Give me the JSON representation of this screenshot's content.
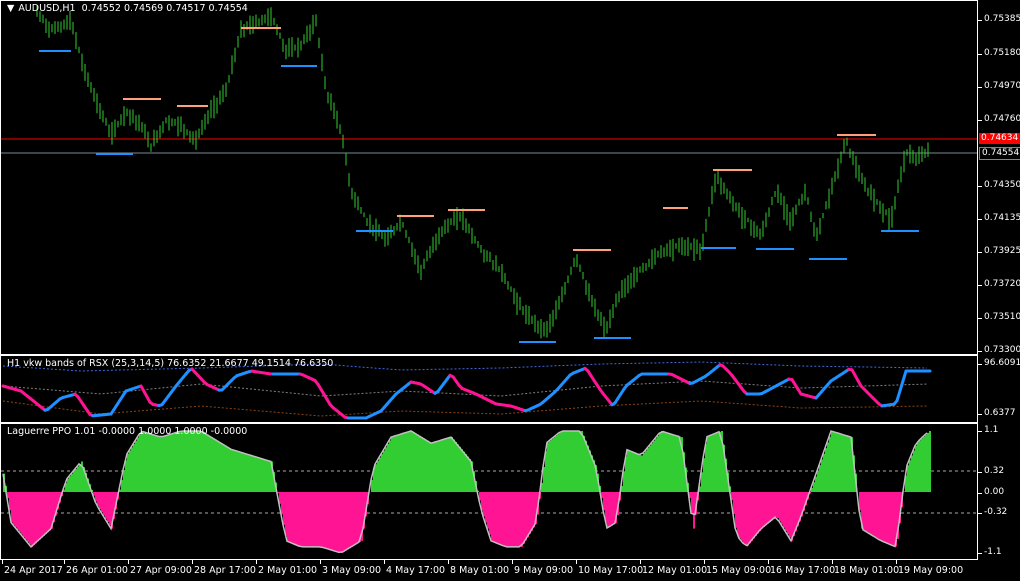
{
  "main": {
    "header": {
      "dropdown_icon": "triangle-down-icon",
      "symbol": "AUDUSD,H1",
      "values": "0.74552 0.74569 0.74517 0.74554"
    },
    "price_ticks": [
      "0.75385",
      "0.75180",
      "0.74970",
      "0.74760",
      "0.74554",
      "0.74350",
      "0.74135",
      "0.73925",
      "0.73720",
      "0.73510",
      "0.73300"
    ],
    "red_price_tag": "0.74634",
    "gray_price_tag": "0.74554",
    "colors": {
      "candles": "#32cd32",
      "support_line": "#1e90ff",
      "resistance_line": "#ffa07a",
      "red_line": "#ff0000",
      "gray_line": "#778899"
    }
  },
  "rsx_pane": {
    "label": "H1 vkw bands of RSX (25,3,14,5) 76.6352 21.6677 49.1514 76.6350",
    "ticks": [
      "96.6091",
      "0.6377"
    ],
    "colors": {
      "up": "#1e90ff",
      "down": "#ff1493",
      "bands": "#4169e1",
      "mid": "#808080",
      "low": "#8b4513"
    }
  },
  "laguerre_pane": {
    "label": "Laguerre PPO 1.01 -0.0000 1.0000 1.0000 -0.0000",
    "ticks": [
      "1.1",
      "0.32",
      "0.00",
      "-0.32",
      "-1.1"
    ],
    "colors": {
      "positive": "#32cd32",
      "negative": "#ff1493",
      "outline": "#c0c0c0"
    }
  },
  "time_axis": [
    "24 Apr 2017",
    "26 Apr 01:00",
    "27 Apr 09:00",
    "28 Apr 17:00",
    "2 May 01:00",
    "3 May 09:00",
    "4 May 17:00",
    "8 May 01:00",
    "9 May 09:00",
    "10 May 17:00",
    "12 May 01:00",
    "15 May 09:00",
    "16 May 17:00",
    "18 May 01:00",
    "19 May 09:00"
  ]
}
